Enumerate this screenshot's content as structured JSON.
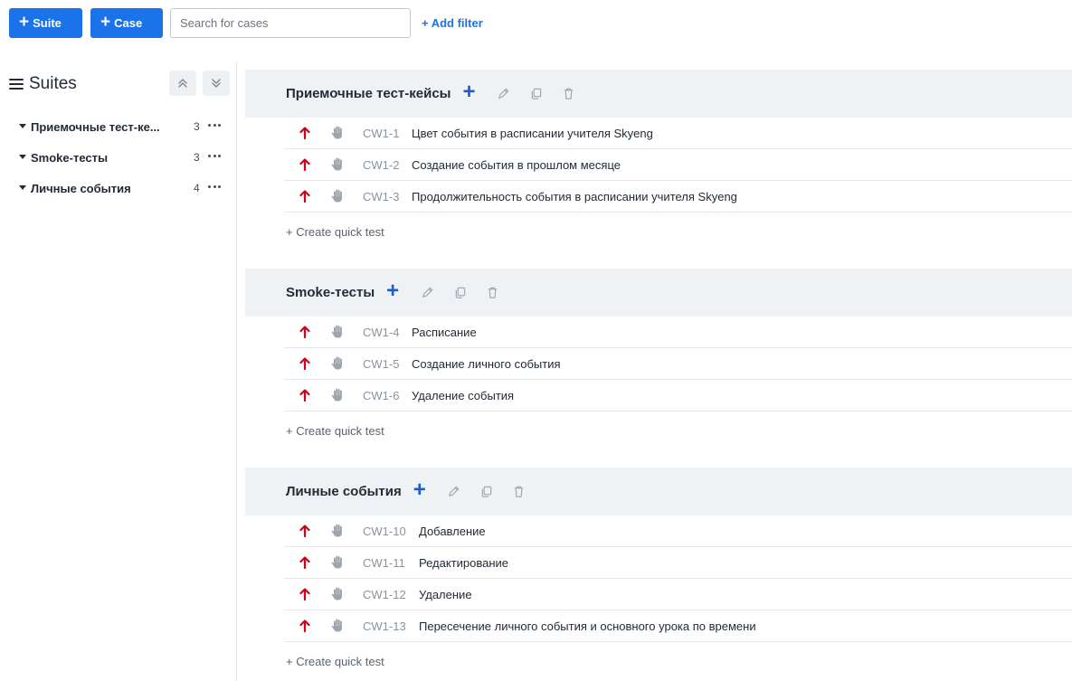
{
  "toolbar": {
    "suite_button": "Suite",
    "case_button": "Case",
    "search_placeholder": "Search for cases",
    "add_filter": "+ Add filter"
  },
  "sidebar": {
    "title": "Suites",
    "items": [
      {
        "label": "Приемочные тест-ке...",
        "count": "3"
      },
      {
        "label": "Smoke-тесты",
        "count": "3"
      },
      {
        "label": "Личные события",
        "count": "4"
      }
    ]
  },
  "suites": [
    {
      "title": "Приемочные тест-кейсы",
      "cases": [
        {
          "id": "CW1-1",
          "title": "Цвет события в расписании учителя Skyeng"
        },
        {
          "id": "CW1-2",
          "title": "Создание события в прошлом месяце"
        },
        {
          "id": "CW1-3",
          "title": "Продолжительность события в расписании учителя Skyeng"
        }
      ],
      "quick_test": "+ Create quick test"
    },
    {
      "title": "Smoke-тесты",
      "cases": [
        {
          "id": "CW1-4",
          "title": "Расписание"
        },
        {
          "id": "CW1-5",
          "title": "Создание личного события"
        },
        {
          "id": "CW1-6",
          "title": "Удаление события"
        }
      ],
      "quick_test": "+ Create quick test"
    },
    {
      "title": "Личные события",
      "cases": [
        {
          "id": "CW1-10",
          "title": "Добавление"
        },
        {
          "id": "CW1-11",
          "title": "Редактирование"
        },
        {
          "id": "CW1-12",
          "title": "Удаление"
        },
        {
          "id": "CW1-13",
          "title": "Пересечение личного события и основного урока по времени"
        }
      ],
      "quick_test": "+ Create quick test"
    }
  ],
  "colors": {
    "primary": "#1a73e8",
    "priority_high": "#d0021b",
    "suite_header_bg": "#eef2f4"
  },
  "icons": {
    "priority": "arrow-up-icon",
    "type": "hand-icon",
    "edit": "pencil-icon",
    "copy": "copy-icon",
    "delete": "trash-icon"
  }
}
